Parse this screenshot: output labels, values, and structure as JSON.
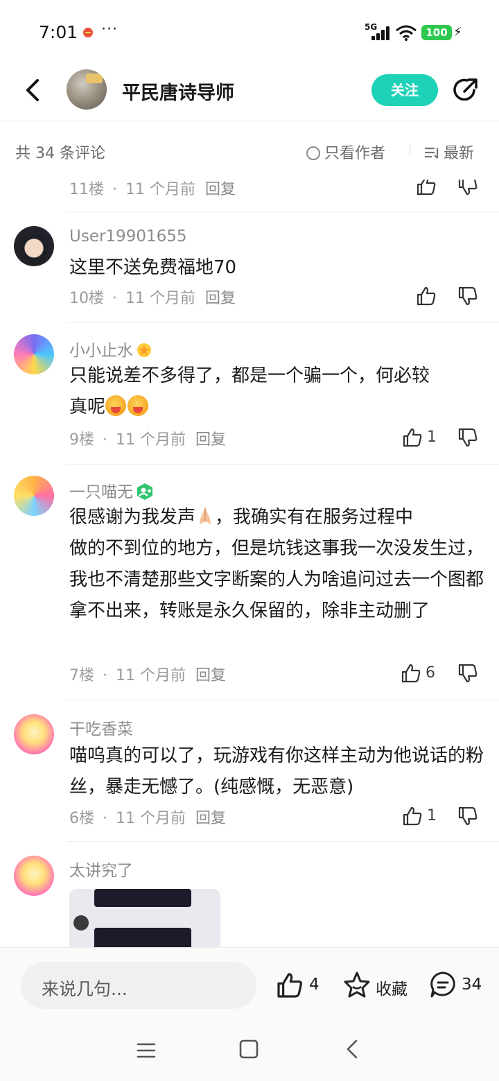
{
  "status_bar": {
    "time": "7:01",
    "more": "···",
    "network": "5G",
    "battery": "100"
  },
  "header": {
    "author_name": "平民唐诗导师",
    "follow_label": "关注"
  },
  "comments_bar": {
    "count_label": "共 34 条评论",
    "author_only_label": "只看作者",
    "sort_label": "最新"
  },
  "comments": [
    {
      "floor": "11楼",
      "time": "11 个月前",
      "reply_label": "回复",
      "likes": ""
    },
    {
      "user": "User19901655",
      "text": "这里不送免费福地70",
      "floor": "10楼",
      "time": "11 个月前",
      "reply_label": "回复",
      "likes": ""
    },
    {
      "user": "小小止水",
      "text_line1": "只能说差不多得了，都是一个骗一个，何必较",
      "text_line2": "真呢",
      "floor": "9楼",
      "time": "11 个月前",
      "reply_label": "回复",
      "likes": "1"
    },
    {
      "user": "一只喵无",
      "text_line1a": "很感谢为我发声",
      "text_line1b": "，我确实有在服务过程中",
      "text_rest": "做的不到位的地方，但是坑钱这事我一次没发生过，我也不清楚那些文字断案的人为啥追问过去一个图都拿不出来，转账是永久保留的，除非主动删了",
      "floor": "7楼",
      "time": "11 个月前",
      "reply_label": "回复",
      "likes": "6"
    },
    {
      "user": "干吃香菜",
      "text": "喵呜真的可以了，玩游戏有你这样主动为他说话的粉丝，暴走无憾了。(纯感慨，无恶意)",
      "floor": "6楼",
      "time": "11 个月前",
      "reply_label": "回复",
      "likes": "1"
    },
    {
      "user": "太讲究了"
    }
  ],
  "bottom_bar": {
    "input_placeholder": "来说几句...",
    "like_count": "4",
    "favorite_label": "收藏",
    "comment_count": "34"
  },
  "colors": {
    "accent": "#1ed2b7",
    "battery": "#2fc84f",
    "meta_text": "#9b9b9b"
  }
}
